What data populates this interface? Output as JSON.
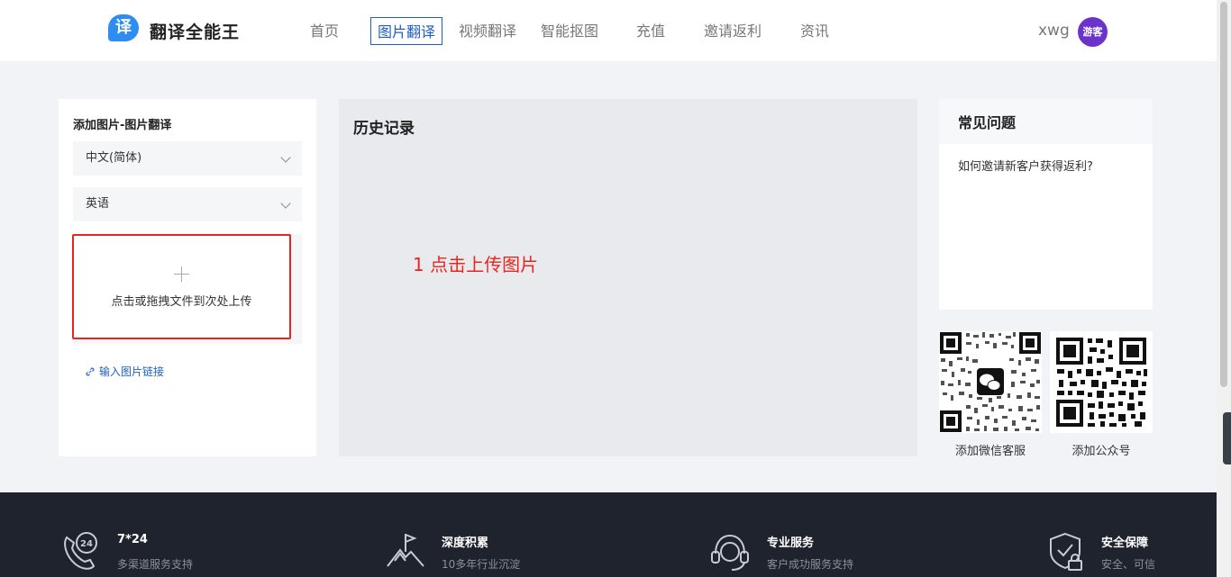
{
  "header": {
    "logo_char": "译",
    "logo_text": "翻译全能王",
    "nav": [
      {
        "label": "首页"
      },
      {
        "label": "图片翻译",
        "active": true
      },
      {
        "label": "视频翻译"
      },
      {
        "label": "智能抠图"
      },
      {
        "label": "充值"
      },
      {
        "label": "邀请返利"
      },
      {
        "label": "资讯"
      }
    ],
    "user_name": "xwg",
    "avatar_label": "游客"
  },
  "left_panel": {
    "title": "添加图片-图片翻译",
    "source_language": "中文(简体)",
    "target_language": "英语",
    "upload_text": "点击或拖拽文件到次处上传",
    "link_text": "输入图片链接"
  },
  "center": {
    "title": "历史记录",
    "annotation": "1 点击上传图片"
  },
  "faq": {
    "title": "常见问题",
    "question": "如何邀请新客户获得返利?"
  },
  "qr": {
    "wechat_label": "添加微信客服",
    "official_label": "添加公众号"
  },
  "footer": {
    "features": [
      {
        "title": "7*24",
        "subtitle": "多渠道服务支持",
        "icon": "phone-24-icon"
      },
      {
        "title": "深度积累",
        "subtitle": "10多年行业沉淀",
        "icon": "mountain-flag-icon"
      },
      {
        "title": "专业服务",
        "subtitle": "客户成功服务支持",
        "icon": "headset-icon"
      },
      {
        "title": "安全保障",
        "subtitle": "安全、可信",
        "icon": "shield-lock-icon"
      }
    ]
  },
  "colors": {
    "accent": "#1e5fbf",
    "highlight_red": "#e8251f",
    "avatar": "#6b33c9",
    "footer_bg": "#1f232d"
  }
}
